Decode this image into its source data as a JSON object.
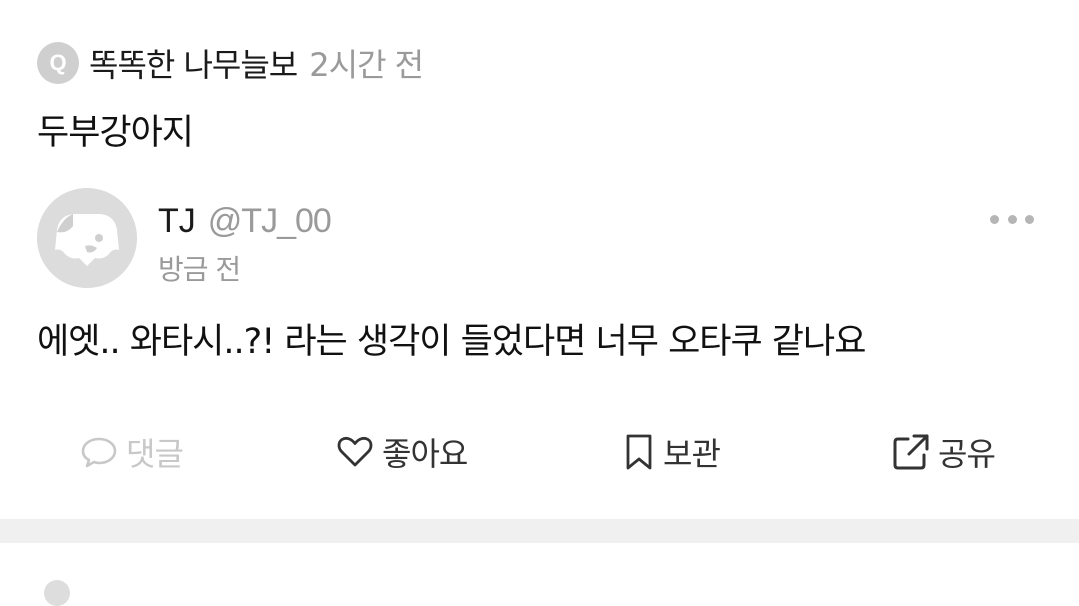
{
  "question": {
    "badge": "Q",
    "asker": "똑똑한 나무늘보",
    "time": "2시간 전",
    "title": "두부강아지"
  },
  "answer": {
    "avatar_icon": "dog-face-icon",
    "author_name": "TJ",
    "author_handle": "@TJ_00",
    "time": "방금 전",
    "body": "에엣.. 와타시..?! 라는 생각이 들었다면 너무 오타쿠 같나요"
  },
  "actions": {
    "comment": {
      "label": "댓글",
      "icon": "speech-bubble-icon",
      "color": "#c8c8c8"
    },
    "like": {
      "label": "좋아요",
      "icon": "heart-icon"
    },
    "save": {
      "label": "보관",
      "icon": "bookmark-icon"
    },
    "share": {
      "label": "공유",
      "icon": "share-icon"
    }
  },
  "colors": {
    "muted": "#9a9a9a",
    "badge": "#cfcfcf",
    "avatar_bg": "#dcdcdc",
    "divider": "#f0f0f0"
  }
}
